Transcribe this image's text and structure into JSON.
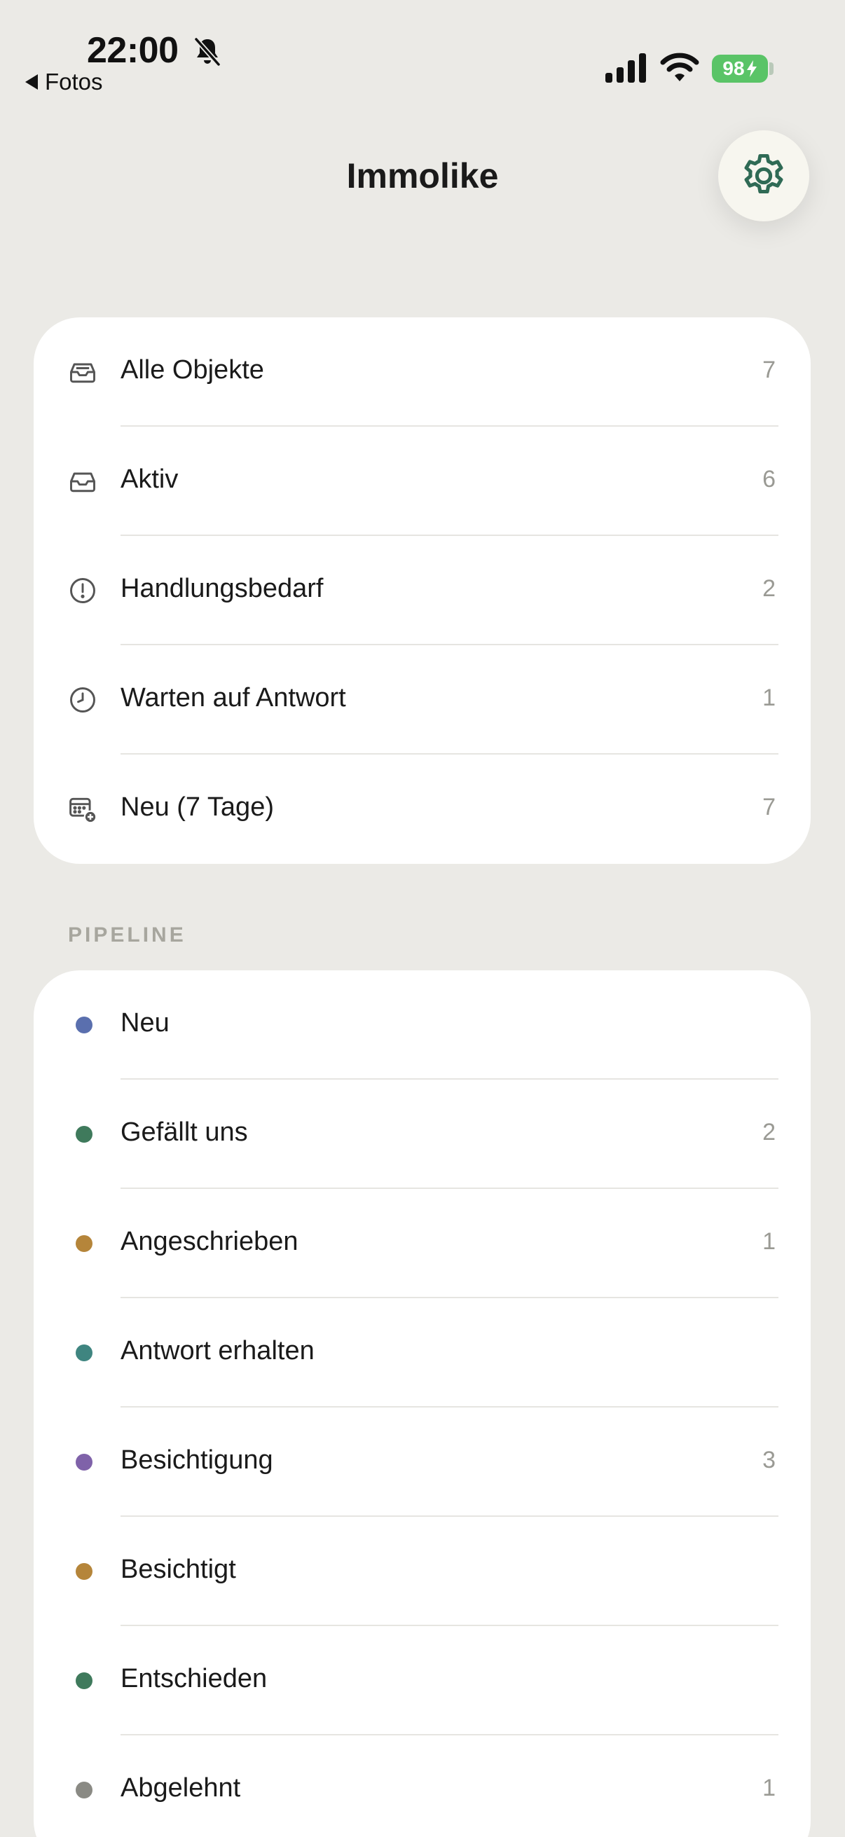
{
  "status_bar": {
    "time": "22:00",
    "back_app": "Fotos",
    "battery": "98"
  },
  "header": {
    "title": "Immolike"
  },
  "overview": [
    {
      "label": "Alle Objekte",
      "count": "7",
      "icon": "tray-full-icon"
    },
    {
      "label": "Aktiv",
      "count": "6",
      "icon": "tray-icon"
    },
    {
      "label": "Handlungsbedarf",
      "count": "2",
      "icon": "exclamation-circle-icon"
    },
    {
      "label": "Warten auf Antwort",
      "count": "1",
      "icon": "clock-icon"
    },
    {
      "label": "Neu (7 Tage)",
      "count": "7",
      "icon": "calendar-plus-icon"
    }
  ],
  "pipeline": {
    "section_title": "PIPELINE",
    "items": [
      {
        "label": "Neu",
        "count": "",
        "color": "#5a6fae"
      },
      {
        "label": "Gefällt uns",
        "count": "2",
        "color": "#3f7a5c"
      },
      {
        "label": "Angeschrieben",
        "count": "1",
        "color": "#b5853a"
      },
      {
        "label": "Antwort erhalten",
        "count": "",
        "color": "#3f8580"
      },
      {
        "label": "Besichtigung",
        "count": "3",
        "color": "#7f62a9"
      },
      {
        "label": "Besichtigt",
        "count": "",
        "color": "#b5853a"
      },
      {
        "label": "Entschieden",
        "count": "",
        "color": "#3f7a5c"
      },
      {
        "label": "Abgelehnt",
        "count": "1",
        "color": "#8a8a84"
      }
    ]
  }
}
